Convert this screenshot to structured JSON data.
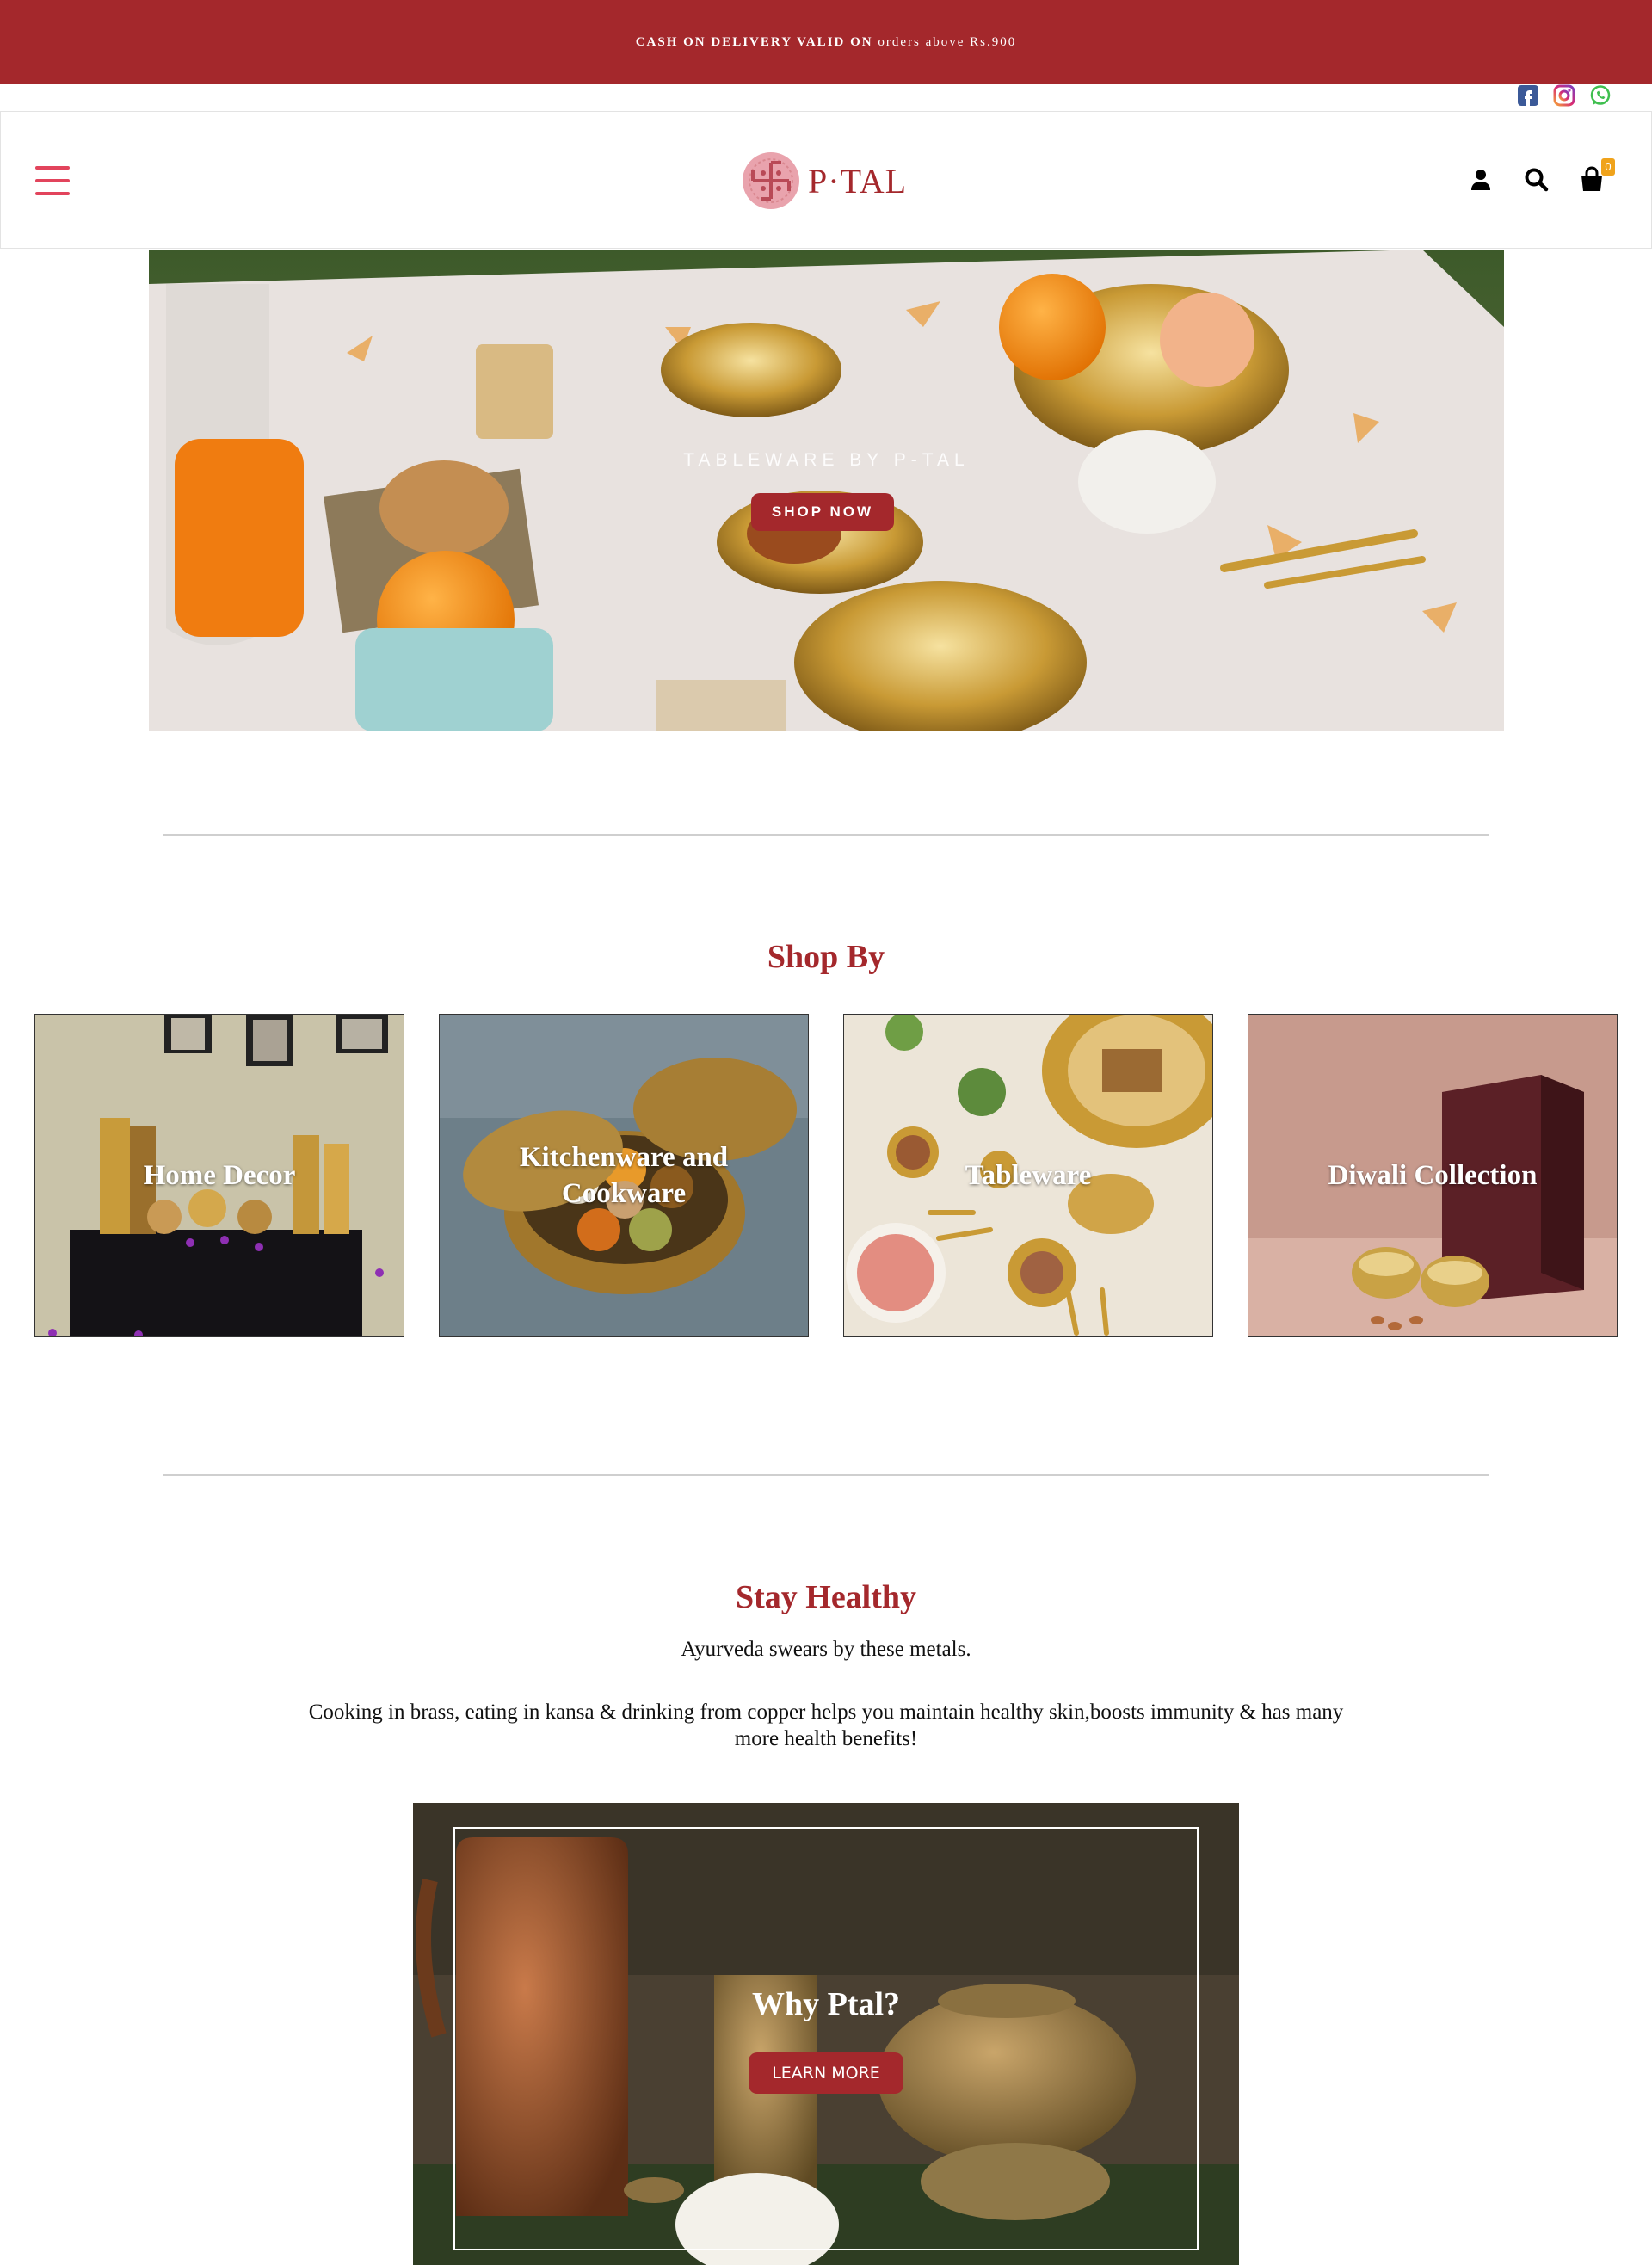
{
  "announcement": {
    "bold_text": "CASH ON DELIVERY VALID ON",
    "regular_text": "orders above Rs.900"
  },
  "social": [
    "facebook-icon",
    "instagram-icon",
    "whatsapp-icon"
  ],
  "header": {
    "logo_text": "P·TAL",
    "cart_count": "0"
  },
  "hero": {
    "eyebrow": "TABLEWARE BY P-TAL",
    "cta": "SHOP NOW"
  },
  "shop_by": {
    "title": "Shop By",
    "categories": [
      {
        "label": "Home Decor"
      },
      {
        "label": "Kitchenware and Cookware"
      },
      {
        "label": "Tableware"
      },
      {
        "label": "Diwali Collection"
      }
    ]
  },
  "stay_healthy": {
    "title": "Stay Healthy",
    "subtitle": "Ayurveda swears by these metals.",
    "body": "Cooking in brass, eating in kansa & drinking from copper helps you maintain healthy skin,boosts immunity & has many more health benefits!"
  },
  "why": {
    "title": "Why Ptal?",
    "cta": "LEARN MORE"
  },
  "colors": {
    "brand_red": "#a4282c",
    "menu_pink": "#e2445c",
    "badge_orange": "#f0a31b"
  }
}
